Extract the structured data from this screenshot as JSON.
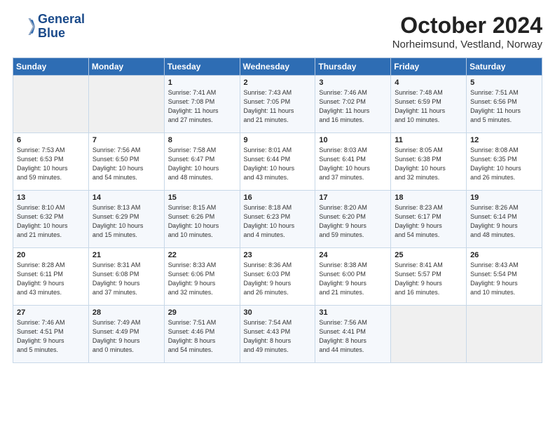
{
  "logo": {
    "line1": "General",
    "line2": "Blue"
  },
  "title": "October 2024",
  "subtitle": "Norheimsund, Vestland, Norway",
  "days_header": [
    "Sunday",
    "Monday",
    "Tuesday",
    "Wednesday",
    "Thursday",
    "Friday",
    "Saturday"
  ],
  "weeks": [
    [
      {
        "day": "",
        "info": ""
      },
      {
        "day": "",
        "info": ""
      },
      {
        "day": "1",
        "info": "Sunrise: 7:41 AM\nSunset: 7:08 PM\nDaylight: 11 hours\nand 27 minutes."
      },
      {
        "day": "2",
        "info": "Sunrise: 7:43 AM\nSunset: 7:05 PM\nDaylight: 11 hours\nand 21 minutes."
      },
      {
        "day": "3",
        "info": "Sunrise: 7:46 AM\nSunset: 7:02 PM\nDaylight: 11 hours\nand 16 minutes."
      },
      {
        "day": "4",
        "info": "Sunrise: 7:48 AM\nSunset: 6:59 PM\nDaylight: 11 hours\nand 10 minutes."
      },
      {
        "day": "5",
        "info": "Sunrise: 7:51 AM\nSunset: 6:56 PM\nDaylight: 11 hours\nand 5 minutes."
      }
    ],
    [
      {
        "day": "6",
        "info": "Sunrise: 7:53 AM\nSunset: 6:53 PM\nDaylight: 10 hours\nand 59 minutes."
      },
      {
        "day": "7",
        "info": "Sunrise: 7:56 AM\nSunset: 6:50 PM\nDaylight: 10 hours\nand 54 minutes."
      },
      {
        "day": "8",
        "info": "Sunrise: 7:58 AM\nSunset: 6:47 PM\nDaylight: 10 hours\nand 48 minutes."
      },
      {
        "day": "9",
        "info": "Sunrise: 8:01 AM\nSunset: 6:44 PM\nDaylight: 10 hours\nand 43 minutes."
      },
      {
        "day": "10",
        "info": "Sunrise: 8:03 AM\nSunset: 6:41 PM\nDaylight: 10 hours\nand 37 minutes."
      },
      {
        "day": "11",
        "info": "Sunrise: 8:05 AM\nSunset: 6:38 PM\nDaylight: 10 hours\nand 32 minutes."
      },
      {
        "day": "12",
        "info": "Sunrise: 8:08 AM\nSunset: 6:35 PM\nDaylight: 10 hours\nand 26 minutes."
      }
    ],
    [
      {
        "day": "13",
        "info": "Sunrise: 8:10 AM\nSunset: 6:32 PM\nDaylight: 10 hours\nand 21 minutes."
      },
      {
        "day": "14",
        "info": "Sunrise: 8:13 AM\nSunset: 6:29 PM\nDaylight: 10 hours\nand 15 minutes."
      },
      {
        "day": "15",
        "info": "Sunrise: 8:15 AM\nSunset: 6:26 PM\nDaylight: 10 hours\nand 10 minutes."
      },
      {
        "day": "16",
        "info": "Sunrise: 8:18 AM\nSunset: 6:23 PM\nDaylight: 10 hours\nand 4 minutes."
      },
      {
        "day": "17",
        "info": "Sunrise: 8:20 AM\nSunset: 6:20 PM\nDaylight: 9 hours\nand 59 minutes."
      },
      {
        "day": "18",
        "info": "Sunrise: 8:23 AM\nSunset: 6:17 PM\nDaylight: 9 hours\nand 54 minutes."
      },
      {
        "day": "19",
        "info": "Sunrise: 8:26 AM\nSunset: 6:14 PM\nDaylight: 9 hours\nand 48 minutes."
      }
    ],
    [
      {
        "day": "20",
        "info": "Sunrise: 8:28 AM\nSunset: 6:11 PM\nDaylight: 9 hours\nand 43 minutes."
      },
      {
        "day": "21",
        "info": "Sunrise: 8:31 AM\nSunset: 6:08 PM\nDaylight: 9 hours\nand 37 minutes."
      },
      {
        "day": "22",
        "info": "Sunrise: 8:33 AM\nSunset: 6:06 PM\nDaylight: 9 hours\nand 32 minutes."
      },
      {
        "day": "23",
        "info": "Sunrise: 8:36 AM\nSunset: 6:03 PM\nDaylight: 9 hours\nand 26 minutes."
      },
      {
        "day": "24",
        "info": "Sunrise: 8:38 AM\nSunset: 6:00 PM\nDaylight: 9 hours\nand 21 minutes."
      },
      {
        "day": "25",
        "info": "Sunrise: 8:41 AM\nSunset: 5:57 PM\nDaylight: 9 hours\nand 16 minutes."
      },
      {
        "day": "26",
        "info": "Sunrise: 8:43 AM\nSunset: 5:54 PM\nDaylight: 9 hours\nand 10 minutes."
      }
    ],
    [
      {
        "day": "27",
        "info": "Sunrise: 7:46 AM\nSunset: 4:51 PM\nDaylight: 9 hours\nand 5 minutes."
      },
      {
        "day": "28",
        "info": "Sunrise: 7:49 AM\nSunset: 4:49 PM\nDaylight: 9 hours\nand 0 minutes."
      },
      {
        "day": "29",
        "info": "Sunrise: 7:51 AM\nSunset: 4:46 PM\nDaylight: 8 hours\nand 54 minutes."
      },
      {
        "day": "30",
        "info": "Sunrise: 7:54 AM\nSunset: 4:43 PM\nDaylight: 8 hours\nand 49 minutes."
      },
      {
        "day": "31",
        "info": "Sunrise: 7:56 AM\nSunset: 4:41 PM\nDaylight: 8 hours\nand 44 minutes."
      },
      {
        "day": "",
        "info": ""
      },
      {
        "day": "",
        "info": ""
      }
    ]
  ]
}
